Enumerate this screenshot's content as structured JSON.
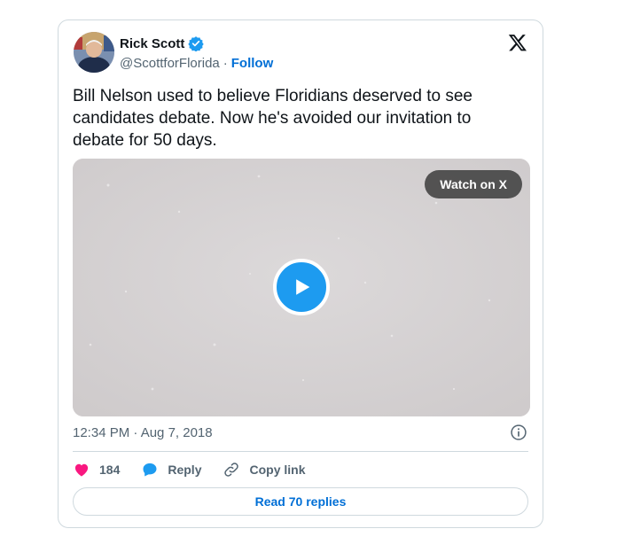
{
  "author": {
    "name": "Rick Scott",
    "handle": "@ScottforFlorida",
    "separator": "·",
    "follow_label": "Follow"
  },
  "tweet": {
    "text_lines": [
      "Bill Nelson used to believe Floridians deserved to see",
      "candidates debate. Now he's avoided our invitation to",
      "debate for 50 days."
    ]
  },
  "media": {
    "watch_label": "Watch on X",
    "play_color": "#1d9bf0"
  },
  "meta": {
    "timestamp": "12:34 PM · Aug 7, 2018"
  },
  "actions": {
    "likes": "184",
    "reply_label": "Reply",
    "copy_label": "Copy link"
  },
  "replies_button": "Read 70 replies",
  "colors": {
    "accent": "#006fd6",
    "like": "#f91880",
    "verified": "#1d9bf0"
  }
}
